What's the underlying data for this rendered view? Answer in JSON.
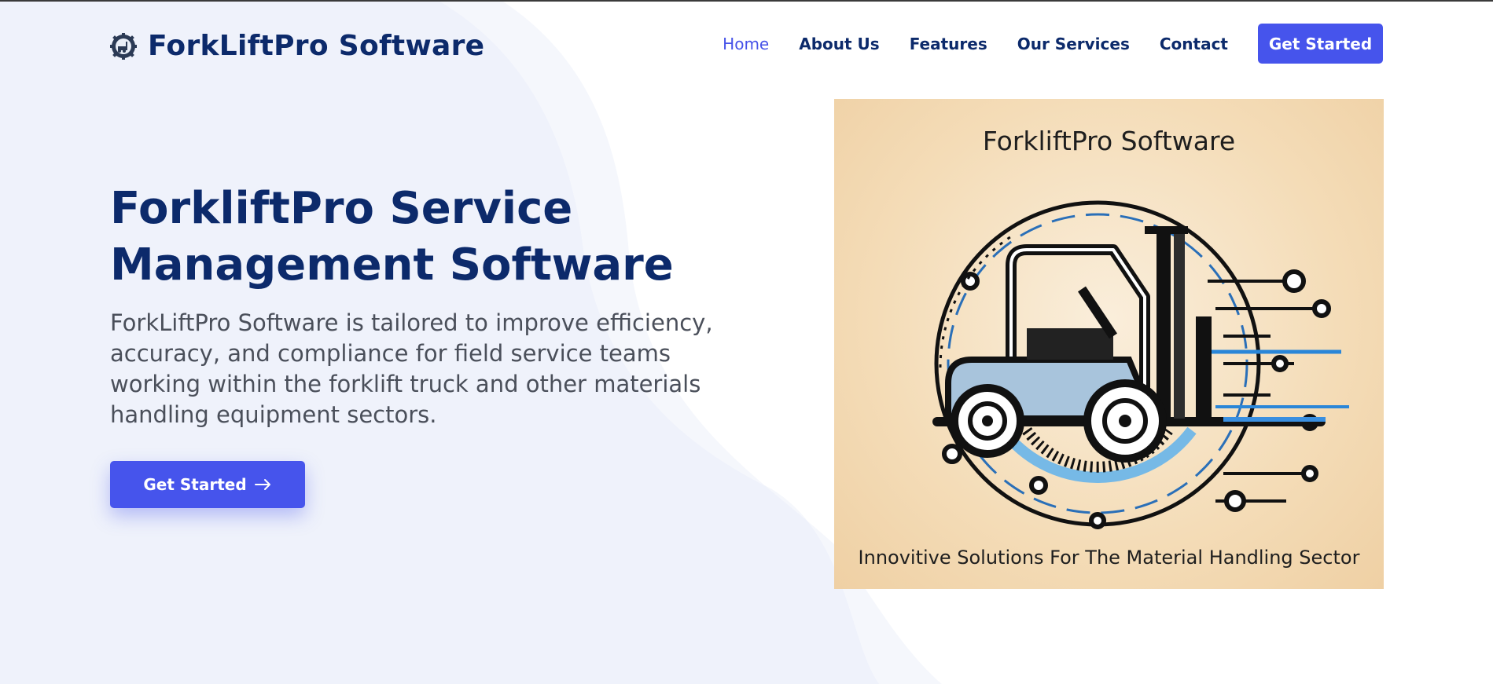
{
  "brand": {
    "name": "ForkLiftPro Software",
    "logo_icon": "gear-forklift-logo-icon"
  },
  "nav": {
    "items": [
      {
        "label": "Home",
        "active": true
      },
      {
        "label": "About Us",
        "active": false
      },
      {
        "label": "Features",
        "active": false
      },
      {
        "label": "Our Services",
        "active": false
      },
      {
        "label": "Contact",
        "active": false
      }
    ],
    "cta_label": "Get Started"
  },
  "hero": {
    "title_line1": "ForkliftPro Service",
    "title_line2": "Management Software",
    "description": "ForkLiftPro Software is tailored to improve efficiency, accuracy, and compliance for field service teams working within the forklift truck and other materials handling equipment sectors.",
    "cta_label": "Get Started",
    "cta_icon": "arrow-right-icon"
  },
  "hero_image": {
    "title": "ForkliftPro Software",
    "tagline": "Innovitive Solutions For The Material Handling Sector"
  },
  "colors": {
    "primary": "#4654ec",
    "heading": "#0c2a6b",
    "body_text": "#4a4f5a",
    "active_nav": "#4652e8",
    "image_bg": "#f4dcb7"
  }
}
